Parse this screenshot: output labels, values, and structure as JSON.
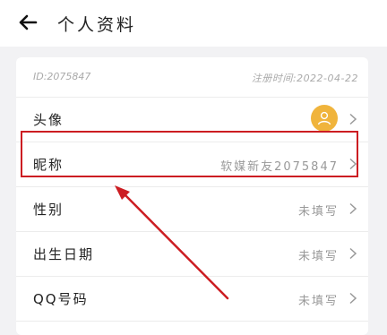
{
  "header": {
    "title": "个人资料"
  },
  "profile": {
    "id_text": "ID:2075847",
    "register_text": "注册时间:2022-04-22"
  },
  "rows": [
    {
      "label": "头像",
      "value": ""
    },
    {
      "label": "昵称",
      "value": "软媒新友2075847"
    },
    {
      "label": "性别",
      "value": "未填写"
    },
    {
      "label": "出生日期",
      "value": "未填写"
    },
    {
      "label": "QQ号码",
      "value": "未填写"
    }
  ],
  "colors": {
    "accent_avatar": "#f0b43c",
    "annotation": "#cc1d22"
  },
  "icons": {
    "back": "arrow-left-icon",
    "avatar": "user-icon",
    "chevron": "chevron-right-icon"
  }
}
